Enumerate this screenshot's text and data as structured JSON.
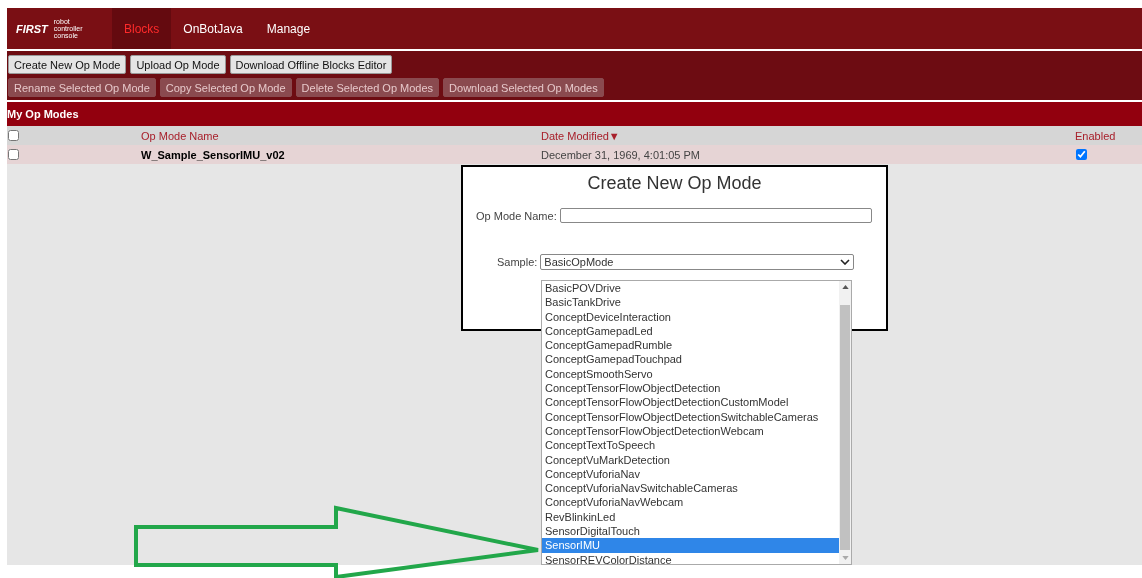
{
  "logo": {
    "brand": "FIRST",
    "subtitle": [
      "robot",
      "controller",
      "console"
    ]
  },
  "tabs": [
    {
      "label": "Blocks",
      "selected": true
    },
    {
      "label": "OnBotJava",
      "selected": false
    },
    {
      "label": "Manage",
      "selected": false
    }
  ],
  "toolbar": [
    {
      "label": "Create New Op Mode",
      "disabled": false
    },
    {
      "label": "Upload Op Mode",
      "disabled": false
    },
    {
      "label": "Download Offline Blocks Editor",
      "disabled": false
    }
  ],
  "toolbar_selected": [
    {
      "label": "Rename Selected Op Mode",
      "disabled": true
    },
    {
      "label": "Copy Selected Op Mode",
      "disabled": true
    },
    {
      "label": "Delete Selected Op Modes",
      "disabled": true
    },
    {
      "label": "Download Selected Op Modes",
      "disabled": true
    }
  ],
  "section_title": "My Op Modes",
  "table": {
    "select_all_checked": false,
    "columns": [
      "Op Mode Name",
      "Date Modified",
      "Enabled"
    ],
    "sort_indicator": "▼",
    "rows": [
      {
        "checked": false,
        "name": "W_Sample_SensorIMU_v02",
        "date": "December 31, 1969, 4:01:05 PM",
        "enabled": true
      }
    ]
  },
  "dialog": {
    "title": "Create New Op Mode",
    "name_label": "Op Mode Name:",
    "sample_label": "Sample:",
    "sample_value": "BasicOpMode",
    "options": [
      {
        "label": "BasicPOVDrive",
        "selected": false
      },
      {
        "label": "BasicTankDrive",
        "selected": false
      },
      {
        "label": "ConceptDeviceInteraction",
        "selected": false
      },
      {
        "label": "ConceptGamepadLed",
        "selected": false
      },
      {
        "label": "ConceptGamepadRumble",
        "selected": false
      },
      {
        "label": "ConceptGamepadTouchpad",
        "selected": false
      },
      {
        "label": "ConceptSmoothServo",
        "selected": false
      },
      {
        "label": "ConceptTensorFlowObjectDetection",
        "selected": false
      },
      {
        "label": "ConceptTensorFlowObjectDetectionCustomModel",
        "selected": false
      },
      {
        "label": "ConceptTensorFlowObjectDetectionSwitchableCameras",
        "selected": false
      },
      {
        "label": "ConceptTensorFlowObjectDetectionWebcam",
        "selected": false
      },
      {
        "label": "ConceptTextToSpeech",
        "selected": false
      },
      {
        "label": "ConceptVuMarkDetection",
        "selected": false
      },
      {
        "label": "ConceptVuforiaNav",
        "selected": false
      },
      {
        "label": "ConceptVuforiaNavSwitchableCameras",
        "selected": false
      },
      {
        "label": "ConceptVuforiaNavWebcam",
        "selected": false
      },
      {
        "label": "RevBlinkinLed",
        "selected": false
      },
      {
        "label": "SensorDigitalTouch",
        "selected": false
      },
      {
        "label": "SensorIMU",
        "selected": true
      },
      {
        "label": "SensorREVColorDistance",
        "selected": false
      }
    ]
  }
}
